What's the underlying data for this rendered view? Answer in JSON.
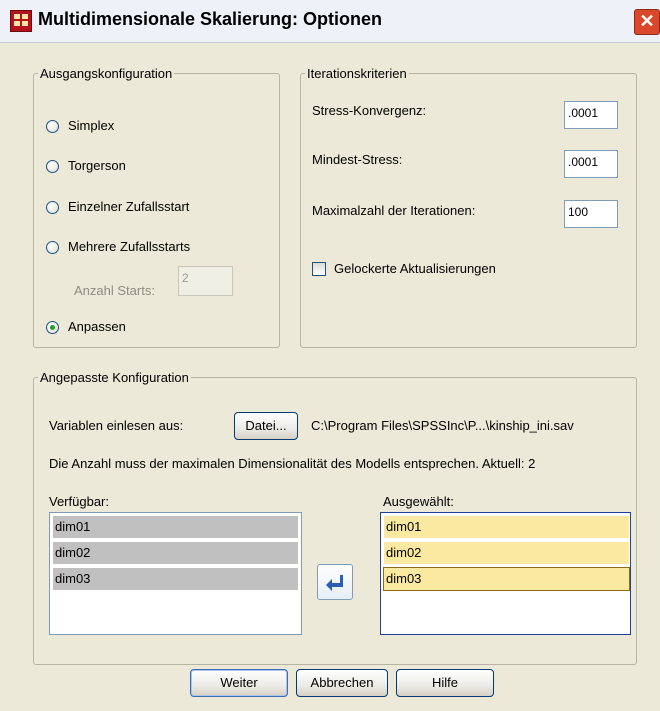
{
  "window": {
    "title": "Multidimensionale Skalierung: Optionen",
    "close_glyph": "✕"
  },
  "ausgang": {
    "legend": "Ausgangskonfiguration",
    "simplex": "Simplex",
    "torgerson": "Torgerson",
    "einzelner": "Einzelner Zufallsstart",
    "mehrere": "Mehrere Zufallsstarts",
    "anzahl_label": "Anzahl Starts:",
    "anzahl_value": "2",
    "anpassen": "Anpassen",
    "selected": "Anpassen"
  },
  "iteration": {
    "legend": "Iterationskriterien",
    "stress_konv_label": "Stress-Konvergenz:",
    "stress_konv_value": ".0001",
    "mindest_label": "Mindest-Stress:",
    "mindest_value": ".0001",
    "max_label": "Maximalzahl der Iterationen:",
    "max_value": "100",
    "gelockert_label": "Gelockerte Aktualisierungen",
    "gelockert_checked": false
  },
  "angepasst": {
    "legend": "Angepasste Konfiguration",
    "lesen_label": "Variablen einlesen aus:",
    "datei_button": "Datei...",
    "file_path": "C:\\Program Files\\SPSSInc\\P...\\kinship_ini.sav",
    "info": "Die Anzahl muss der maximalen Dimensionalität des Modells entsprechen. Aktuell: 2",
    "verfuegbar_label": "Verfügbar:",
    "verfuegbar_items": [
      "dim01",
      "dim02",
      "dim03"
    ],
    "ausgewaehlt_label": "Ausgewählt:",
    "ausgewaehlt_items": [
      "dim01",
      "dim02",
      "dim03"
    ],
    "arrow_icon": "arrow-left-icon"
  },
  "buttons": {
    "weiter": "Weiter",
    "abbrechen": "Abbrechen",
    "hilfe": "Hilfe"
  },
  "colors": {
    "dialog_bg": "#ece9d8",
    "selected_item": "#fce9a1",
    "unavailable_item": "#c0c0c0",
    "accent_blue": "#2b5fb0"
  }
}
